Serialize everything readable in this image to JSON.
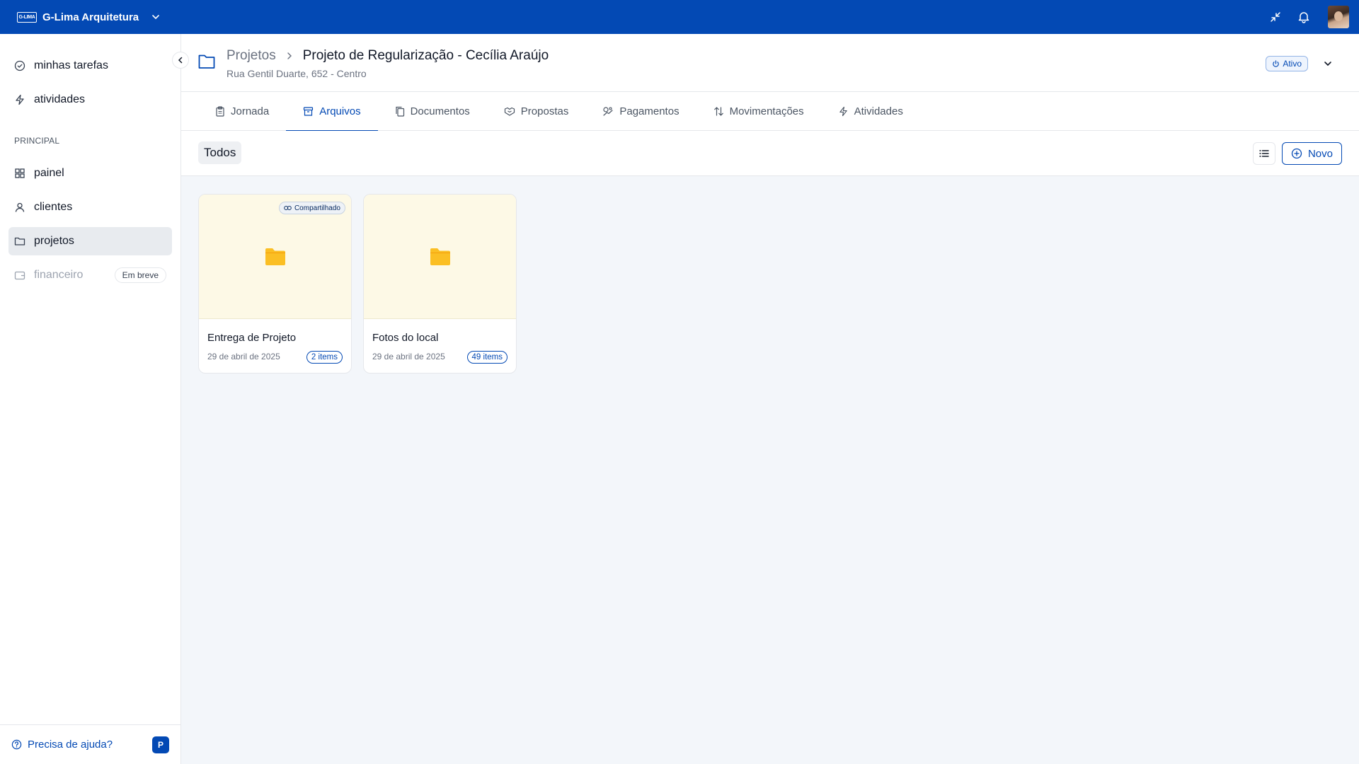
{
  "topbar": {
    "org_name": "G-Lima Arquitetura",
    "logo_text": "G-LIMA",
    "icons": [
      "chevron-down-icon",
      "minimize-icon",
      "bell-icon"
    ]
  },
  "sidebar": {
    "items_top": [
      {
        "label": "minhas tarefas",
        "icon": "check-circle-icon"
      },
      {
        "label": "atividades",
        "icon": "zap-icon"
      }
    ],
    "section_label": "PRINCIPAL",
    "items_main": [
      {
        "label": "painel",
        "icon": "grid-icon"
      },
      {
        "label": "clientes",
        "icon": "user-icon"
      },
      {
        "label": "projetos",
        "icon": "folder-icon",
        "active": true
      },
      {
        "label": "financeiro",
        "icon": "wallet-icon",
        "disabled": true,
        "badge": "Em breve"
      }
    ],
    "footer": {
      "help_label": "Precisa de ajuda?",
      "user_initial": "P"
    }
  },
  "header": {
    "breadcrumb_parent": "Projetos",
    "title": "Projeto de Regularização - Cecília Araújo",
    "address": "Rua Gentil Duarte, 652 - Centro",
    "status": "Ativo"
  },
  "tabs": [
    {
      "label": "Jornada",
      "icon": "clipboard-icon"
    },
    {
      "label": "Arquivos",
      "icon": "archive-icon",
      "active": true
    },
    {
      "label": "Documentos",
      "icon": "copy-icon"
    },
    {
      "label": "Propostas",
      "icon": "handshake-icon"
    },
    {
      "label": "Pagamentos",
      "icon": "payments-icon"
    },
    {
      "label": "Movimentações",
      "icon": "arrows-up-down-icon"
    },
    {
      "label": "Atividades",
      "icon": "zap-icon"
    }
  ],
  "toolbar": {
    "filter": "Todos",
    "new_label": "Novo"
  },
  "folders": [
    {
      "name": "Entrega de Projeto",
      "date": "29 de abril de 2025",
      "count": "2 items",
      "shared": "Compartilhado"
    },
    {
      "name": "Fotos do local",
      "date": "29 de abril de 2025",
      "count": "49 items"
    }
  ],
  "colors": {
    "primary": "#0349b4",
    "folder": "#fbbf24",
    "thumb_bg": "#fdf9e6"
  }
}
